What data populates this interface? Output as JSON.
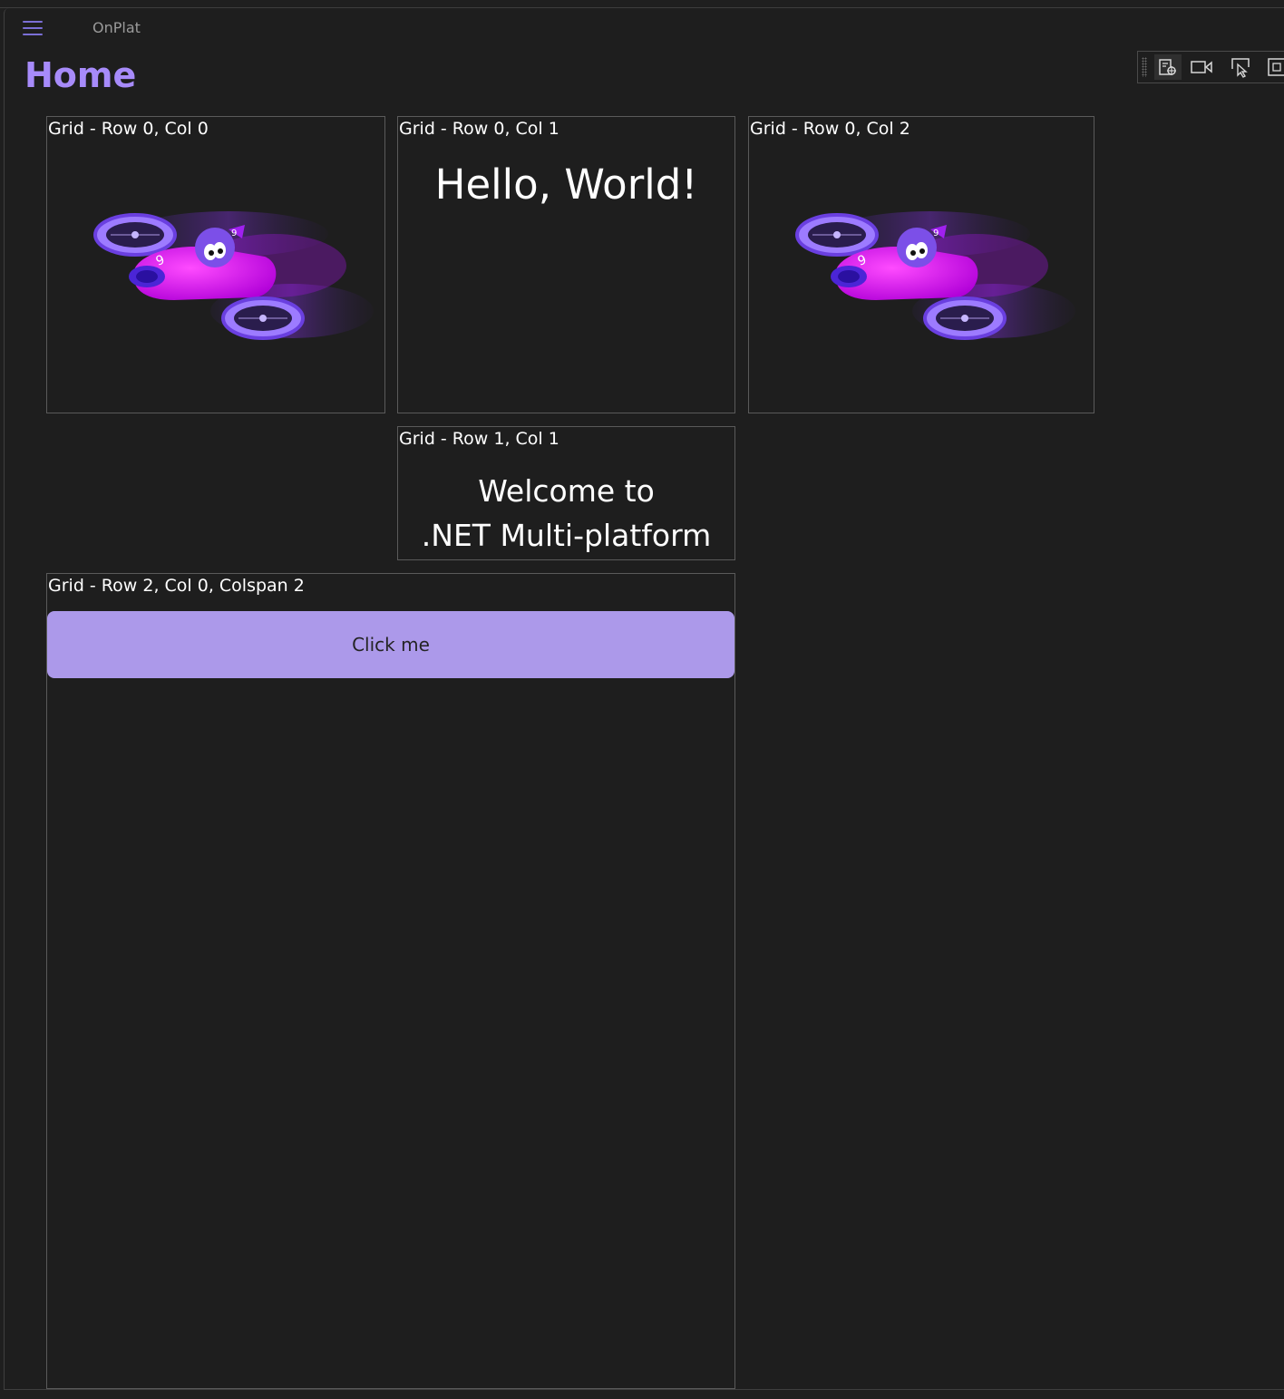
{
  "app": {
    "title": "OnPlat"
  },
  "page": {
    "title": "Home"
  },
  "grid": {
    "cell_0_0_label": "Grid - Row 0, Col 0",
    "cell_0_1_label": "Grid - Row 0, Col 1",
    "cell_0_1_text": "Hello, World!",
    "cell_0_2_label": "Grid - Row 0, Col 2",
    "cell_1_1_label": "Grid - Row 1, Col 1",
    "cell_1_1_line1": "Welcome to",
    "cell_1_1_line2": ".NET Multi-platform",
    "cell_2_0_label": "Grid - Row 2, Col 0, Colspan 2",
    "button_label": "Click me"
  },
  "icons": {
    "menu": "hamburger-menu-icon",
    "toolbar": [
      "live-visual-tree-icon",
      "record-icon",
      "select-element-icon",
      "display-layout-adorners-icon"
    ],
    "image": "dotnet-bot-image"
  },
  "colors": {
    "accent": "#a78bfa",
    "button_bg": "#ac99ea",
    "background": "#1e1e1e"
  }
}
